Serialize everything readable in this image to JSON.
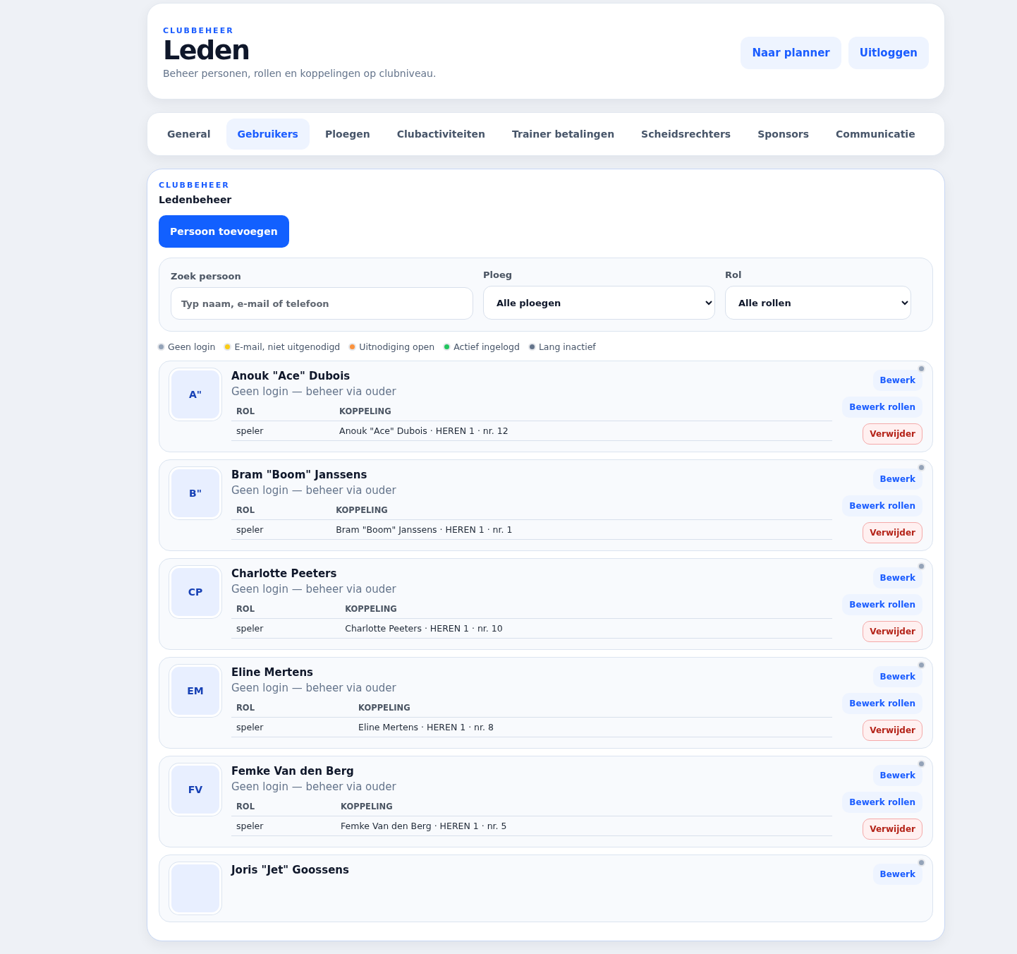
{
  "header": {
    "eyebrow": "CLUBBEHEER",
    "title": "Leden",
    "subtitle": "Beheer personen, rollen en koppelingen op clubniveau.",
    "buttons": [
      "Naar planner",
      "Uitloggen"
    ]
  },
  "tabs": [
    {
      "label": "General",
      "selected": false
    },
    {
      "label": "Gebruikers",
      "selected": true
    },
    {
      "label": "Ploegen",
      "selected": false
    },
    {
      "label": "Clubactiviteiten",
      "selected": false
    },
    {
      "label": "Trainer betalingen",
      "selected": false
    },
    {
      "label": "Scheidsrechters",
      "selected": false
    },
    {
      "label": "Sponsors",
      "selected": false
    },
    {
      "label": "Communicatie",
      "selected": false
    }
  ],
  "panel": {
    "eyebrow": "CLUBBEHEER",
    "title": "Ledenbeheer",
    "add_button": "Persoon toevoegen",
    "filters": {
      "search": {
        "label": "Zoek persoon",
        "placeholder": "Typ naam, e-mail of telefoon"
      },
      "team": {
        "label": "Ploeg",
        "value": "Alle ploegen"
      },
      "role": {
        "label": "Rol",
        "value": "Alle rollen"
      }
    },
    "legend": [
      {
        "label": "Geen login",
        "color": "#94a3b8"
      },
      {
        "label": "E-mail, niet uitgenodigd",
        "color": "#facc15"
      },
      {
        "label": "Uitnodiging open",
        "color": "#fb923c"
      },
      {
        "label": "Actief ingelogd",
        "color": "#22c55e"
      },
      {
        "label": "Lang inactief",
        "color": "#64748b"
      }
    ],
    "members": [
      {
        "initials": "A\"",
        "name": "Anouk \"Ace\" Dubois",
        "status": "Geen login — beheer via ouder",
        "color": "#94a3b8",
        "columns": [
          "ROL",
          "KOPPELING"
        ],
        "rows": [
          [
            "speler",
            "Anouk \"Ace\" Dubois · HEREN 1 · nr. 12"
          ]
        ],
        "actions": [
          "Bewerk",
          "Bewerk rollen",
          "Verwijder"
        ]
      },
      {
        "initials": "B\"",
        "name": "Bram \"Boom\" Janssens",
        "status": "Geen login — beheer via ouder",
        "color": "#94a3b8",
        "columns": [
          "ROL",
          "KOPPELING"
        ],
        "rows": [
          [
            "speler",
            "Bram \"Boom\" Janssens · HEREN 1 · nr. 1"
          ]
        ],
        "actions": [
          "Bewerk",
          "Bewerk rollen",
          "Verwijder"
        ]
      },
      {
        "initials": "CP",
        "name": "Charlotte Peeters",
        "status": "Geen login — beheer via ouder",
        "color": "#94a3b8",
        "columns": [
          "ROL",
          "KOPPELING"
        ],
        "rows": [
          [
            "speler",
            "Charlotte Peeters · HEREN 1 · nr. 10"
          ]
        ],
        "actions": [
          "Bewerk",
          "Bewerk rollen",
          "Verwijder"
        ]
      },
      {
        "initials": "EM",
        "name": "Eline Mertens",
        "status": "Geen login — beheer via ouder",
        "color": "#94a3b8",
        "columns": [
          "ROL",
          "KOPPELING"
        ],
        "rows": [
          [
            "speler",
            "Eline Mertens · HEREN 1 · nr. 8"
          ]
        ],
        "actions": [
          "Bewerk",
          "Bewerk rollen",
          "Verwijder"
        ]
      },
      {
        "initials": "FV",
        "name": "Femke Van den Berg",
        "status": "Geen login — beheer via ouder",
        "color": "#94a3b8",
        "columns": [
          "ROL",
          "KOPPELING"
        ],
        "rows": [
          [
            "speler",
            "Femke Van den Berg · HEREN 1 · nr. 5"
          ]
        ],
        "actions": [
          "Bewerk",
          "Bewerk rollen",
          "Verwijder"
        ]
      },
      {
        "name": "Joris \"Jet\" Goossens",
        "color": "#94a3b8",
        "actions": [
          "Bewerk"
        ]
      }
    ]
  }
}
